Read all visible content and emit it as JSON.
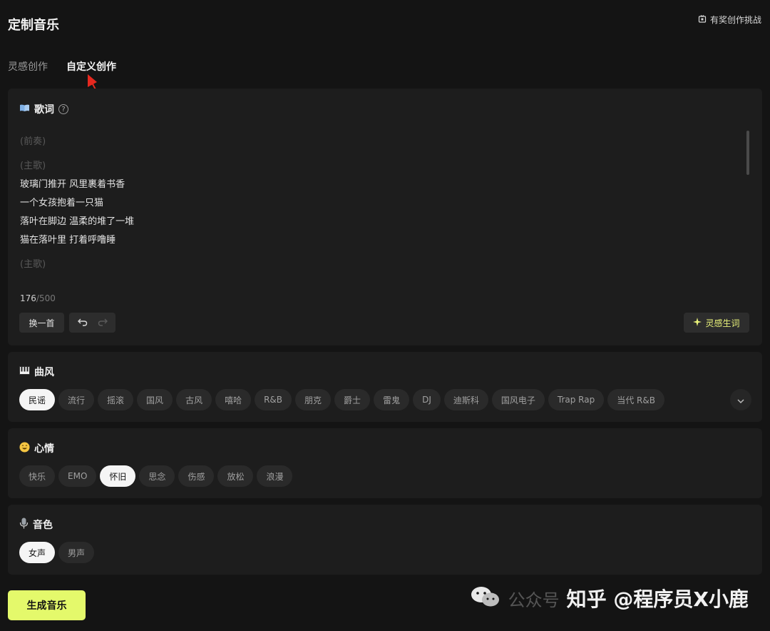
{
  "header": {
    "title": "定制音乐",
    "challenge_label": "有奖创作挑战"
  },
  "tabs": [
    {
      "label": "灵感创作",
      "active": false
    },
    {
      "label": "自定义创作",
      "active": true
    }
  ],
  "lyrics": {
    "heading": "歌词",
    "help": "?",
    "lines": [
      {
        "text": "(前奏)",
        "muted": true
      },
      {
        "text": "(主歌)",
        "muted": true,
        "gap": true
      },
      {
        "text": "玻璃门推开 风里裹着书香",
        "muted": false
      },
      {
        "text": "一个女孩抱着一只猫",
        "muted": false
      },
      {
        "text": "落叶在脚边 温柔的堆了一堆",
        "muted": false
      },
      {
        "text": "猫在落叶里 打着呼噜睡",
        "muted": false
      },
      {
        "text": "(主歌)",
        "muted": true,
        "gap": true
      }
    ],
    "count": "176",
    "max": "/500",
    "refresh_label": "换一首",
    "inspire_label": "灵感生词"
  },
  "style": {
    "heading": "曲风",
    "options": [
      "民谣",
      "流行",
      "摇滚",
      "国风",
      "古风",
      "嘻哈",
      "R&B",
      "朋克",
      "爵士",
      "雷鬼",
      "DJ",
      "迪斯科",
      "国风电子",
      "Trap Rap",
      "当代 R&B"
    ],
    "selected": "民谣"
  },
  "mood": {
    "heading": "心情",
    "options": [
      "快乐",
      "EMO",
      "怀旧",
      "思念",
      "伤感",
      "放松",
      "浪漫"
    ],
    "selected": "怀旧"
  },
  "voice": {
    "heading": "音色",
    "options": [
      "女声",
      "男声"
    ],
    "selected": "女声"
  },
  "generate_label": "生成音乐",
  "watermark": {
    "faint": "公众号",
    "main": "知乎 @程序员X小鹿"
  },
  "colors": {
    "accent": "#e4f96b",
    "background": "#141414",
    "card": "#1d1d1d",
    "arrow": "#e5281f"
  },
  "icons": [
    "gift-box-icon",
    "book-icon",
    "help-icon",
    "undo-icon",
    "redo-icon",
    "sparkle-icon",
    "piano-icon",
    "smile-emoji-icon",
    "microphone-icon",
    "chevron-down-icon",
    "wechat-icon"
  ]
}
